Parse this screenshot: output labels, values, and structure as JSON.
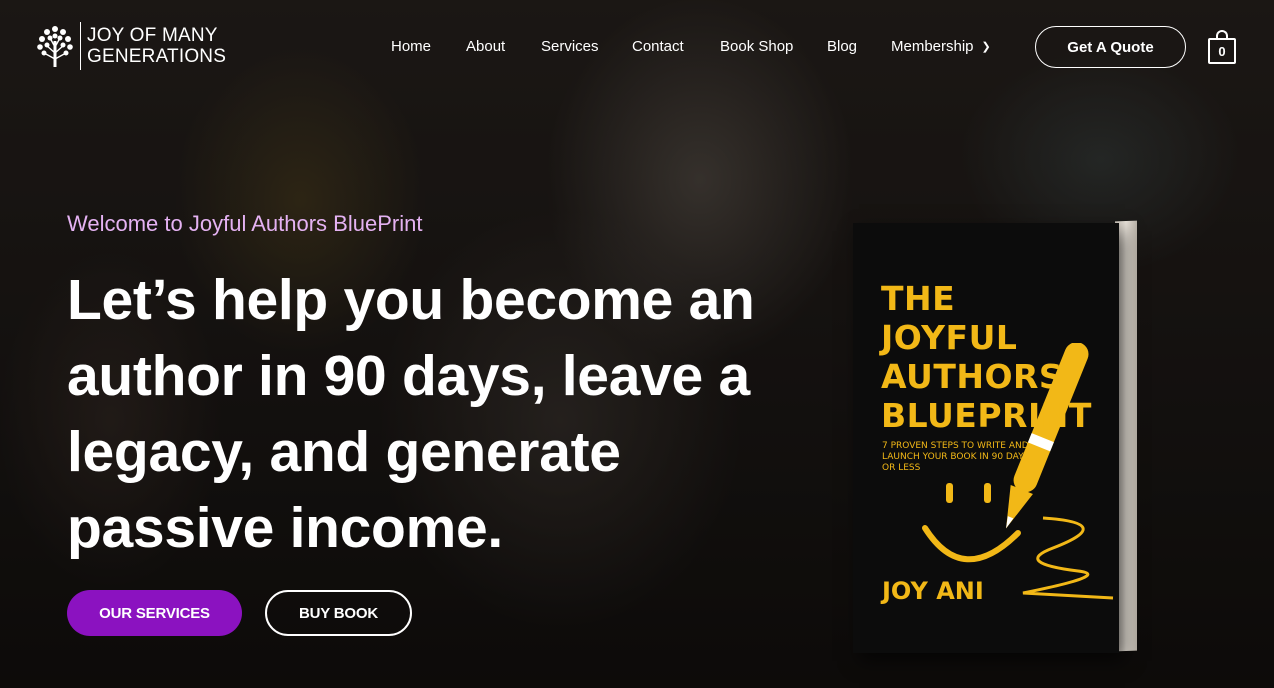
{
  "brand": {
    "line1": "JOY OF MANY",
    "line2": "GENERATIONS",
    "icon": "tree-icon"
  },
  "nav": {
    "items": [
      {
        "label": "Home"
      },
      {
        "label": "About"
      },
      {
        "label": "Services"
      },
      {
        "label": "Contact"
      },
      {
        "label": "Book Shop"
      },
      {
        "label": "Blog"
      },
      {
        "label": "Membership",
        "icon": "chevron-down-icon"
      }
    ],
    "quote_label": "Get A Quote",
    "cart_count": "0",
    "cart_icon": "shopping-bag-icon"
  },
  "hero": {
    "eyebrow": "Welcome to Joyful Authors BluePrint",
    "headline_lines": [
      "Let’s help you become an",
      "author in 90 days, leave a",
      "legacy, and generate",
      "passive income."
    ],
    "primary_button": "OUR SERVICES",
    "secondary_button": "BUY BOOK"
  },
  "book": {
    "title_lines": [
      "THE",
      "JOYFUL",
      "AUTHORS",
      "BLUEPRINT"
    ],
    "subtitle": "7 PROVEN STEPS TO WRITE AND LAUNCH YOUR BOOK IN 90 DAYS OR LESS",
    "author": "JOY ANI"
  },
  "colors": {
    "accent_purple": "#8b12c0",
    "eyebrow_lavender": "#e4b2f2",
    "book_yellow": "#f2b817"
  }
}
